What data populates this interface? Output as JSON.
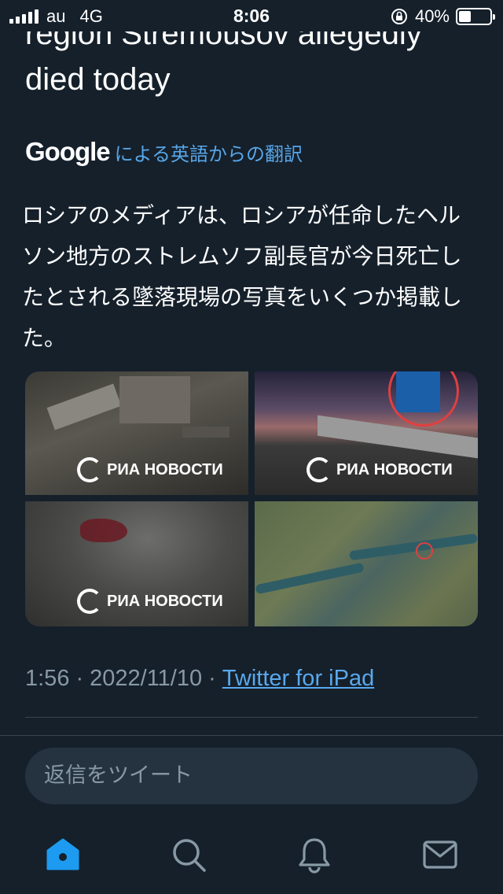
{
  "status_bar": {
    "carrier": "au",
    "network": "4G",
    "time": "8:06",
    "battery_percent": "40%",
    "battery_level": 0.4
  },
  "tweet": {
    "headline_line1": "region Stremousov allegedly",
    "headline_line2": "died today",
    "translate_brand": "Google",
    "translate_label": "による英語からの翻訳",
    "translated_text": "ロシアのメディアは、ロシアが任命したヘルソン地方のストレムソフ副長官が今日死亡したとされる墜落現場の写真をいくつか掲載した。",
    "media_watermark": "РИА НОВОСТИ",
    "time": "1:56",
    "date": "2022/11/10",
    "separator": "·",
    "source": "Twitter for iPad"
  },
  "reply": {
    "placeholder": "返信をツイート"
  },
  "tabbar": {
    "items": [
      "home-icon",
      "search-icon",
      "notifications-icon",
      "messages-icon"
    ],
    "active_color": "#1d9bf0",
    "inactive_color": "#8899a6"
  }
}
